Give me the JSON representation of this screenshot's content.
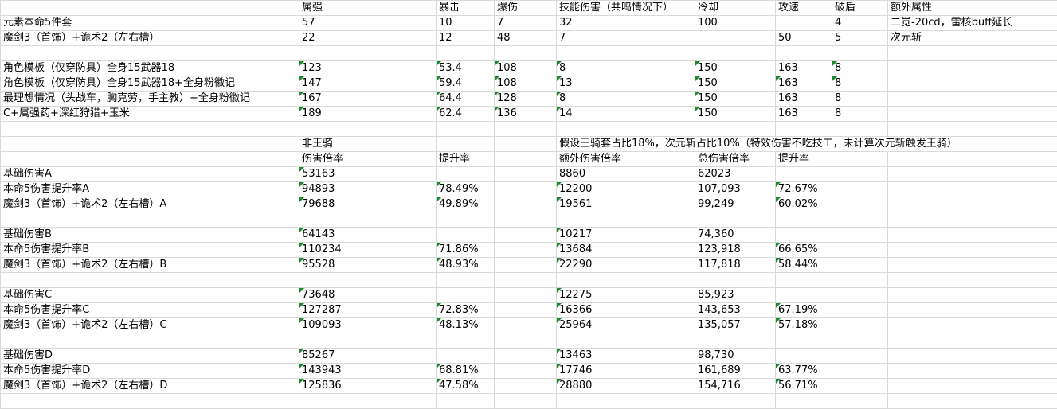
{
  "rows": [
    [
      "",
      "属强",
      "暴击",
      "爆伤",
      "技能伤害（共鸣情况下）",
      "冷却",
      "攻速",
      "破盾",
      "额外属性"
    ],
    [
      "元素本命5件套",
      "57",
      "10",
      "7",
      "32",
      "100",
      "",
      "4",
      "二觉-20cd，雷核buff延长"
    ],
    [
      "魔剑3（首饰）+诡术2（左右槽）",
      "22",
      "12",
      "48",
      "7",
      "",
      "50",
      "5",
      "次元斩"
    ],
    [
      "",
      "",
      "",
      "",
      "",
      "",
      "",
      "",
      ""
    ],
    [
      "角色模板（仅穿防具）全身15武器18",
      "123",
      "53.4",
      "108",
      "8",
      "150",
      "163",
      "8",
      ""
    ],
    [
      "角色模板（仅穿防具）全身15武器18+全身粉徽记",
      "147",
      "59.4",
      "108",
      "13",
      "150",
      "163",
      "8",
      ""
    ],
    [
      "最理想情况（头战车，胸克劳，手主教）+全身粉徽记",
      "167",
      "64.4",
      "128",
      "8",
      "150",
      "163",
      "8",
      ""
    ],
    [
      "C+属强药+深红狩猎+玉米",
      "189",
      "62.4",
      "136",
      "14",
      "150",
      "163",
      "8",
      ""
    ],
    [
      "",
      "",
      "",
      "",
      "",
      "",
      "",
      "",
      ""
    ],
    [
      "",
      "非王骑",
      "",
      "",
      "假设王骑套占比18%，次元斩占比10%（特效伤害不吃技工，未计算次元斩触发王骑）",
      "",
      "",
      "",
      ""
    ],
    [
      "",
      "伤害倍率",
      "提升率",
      "",
      "额外伤害倍率",
      "总伤害倍率",
      "提升率",
      "",
      ""
    ],
    [
      "基础伤害A",
      "53163",
      "",
      "",
      "8860",
      "62023",
      "",
      "",
      ""
    ],
    [
      "本命5伤害提升率A",
      "94893",
      "78.49%",
      "",
      "12200",
      "107,093",
      "72.67%",
      "",
      ""
    ],
    [
      "魔剑3（首饰）+诡术2（左右槽）A",
      "79688",
      "49.89%",
      "",
      "19561",
      "99,249",
      "60.02%",
      "",
      ""
    ],
    [
      "",
      "",
      "",
      "",
      "",
      "",
      "",
      "",
      ""
    ],
    [
      "基础伤害B",
      "64143",
      "",
      "",
      "10217",
      "74,360",
      "",
      "",
      ""
    ],
    [
      "本命5伤害提升率B",
      "110234",
      "71.86%",
      "",
      "13684",
      "123,918",
      "66.65%",
      "",
      ""
    ],
    [
      "魔剑3（首饰）+诡术2（左右槽）B",
      "95528",
      "48.93%",
      "",
      "22290",
      "117,818",
      "58.44%",
      "",
      ""
    ],
    [
      "",
      "",
      "",
      "",
      "",
      "",
      "",
      "",
      ""
    ],
    [
      "基础伤害C",
      "73648",
      "",
      "",
      "12275",
      "85,923",
      "",
      "",
      ""
    ],
    [
      "本命5伤害提升率C",
      "127287",
      "72.83%",
      "",
      "16366",
      "143,653",
      "67.19%",
      "",
      ""
    ],
    [
      "魔剑3（首饰）+诡术2（左右槽）C",
      "109093",
      "48.13%",
      "",
      "25964",
      "135,057",
      "57.18%",
      "",
      ""
    ],
    [
      "",
      "",
      "",
      "",
      "",
      "",
      "",
      "",
      ""
    ],
    [
      "基础伤害D",
      "85267",
      "",
      "",
      "13463",
      "98,730",
      "",
      "",
      ""
    ],
    [
      "本命5伤害提升率D",
      "143943",
      "68.81%",
      "",
      "17746",
      "161,689",
      "63.77%",
      "",
      ""
    ],
    [
      "魔剑3（首饰）+诡术2（左右槽）D",
      "125836",
      "47.58%",
      "",
      "28880",
      "154,716",
      "56.71%",
      "",
      ""
    ],
    [
      "",
      "",
      "",
      "",
      "",
      "",
      "",
      "",
      ""
    ]
  ],
  "tri_cells": [
    "4-1",
    "4-2",
    "4-3",
    "4-4",
    "4-5",
    "4-7",
    "5-1",
    "5-2",
    "5-3",
    "5-4",
    "5-5",
    "5-6",
    "5-7",
    "6-1",
    "6-2",
    "6-3",
    "6-4",
    "6-5",
    "7-1",
    "7-2",
    "7-3",
    "7-4",
    "7-5",
    "11-1",
    "12-1",
    "12-2",
    "12-4",
    "12-6",
    "13-1",
    "13-2",
    "13-4",
    "13-6",
    "15-1",
    "15-4",
    "16-1",
    "16-2",
    "16-4",
    "16-6",
    "17-1",
    "17-2",
    "17-4",
    "17-6",
    "19-1",
    "19-4",
    "20-1",
    "20-2",
    "20-4",
    "20-6",
    "21-1",
    "21-2",
    "21-4",
    "21-6",
    "23-1",
    "23-4",
    "24-1",
    "24-2",
    "24-4",
    "24-6",
    "25-1",
    "25-2",
    "25-4",
    "25-6"
  ],
  "colors": {
    "grid_line": "#d9d9d9",
    "indicator": "#1a8a2a"
  }
}
